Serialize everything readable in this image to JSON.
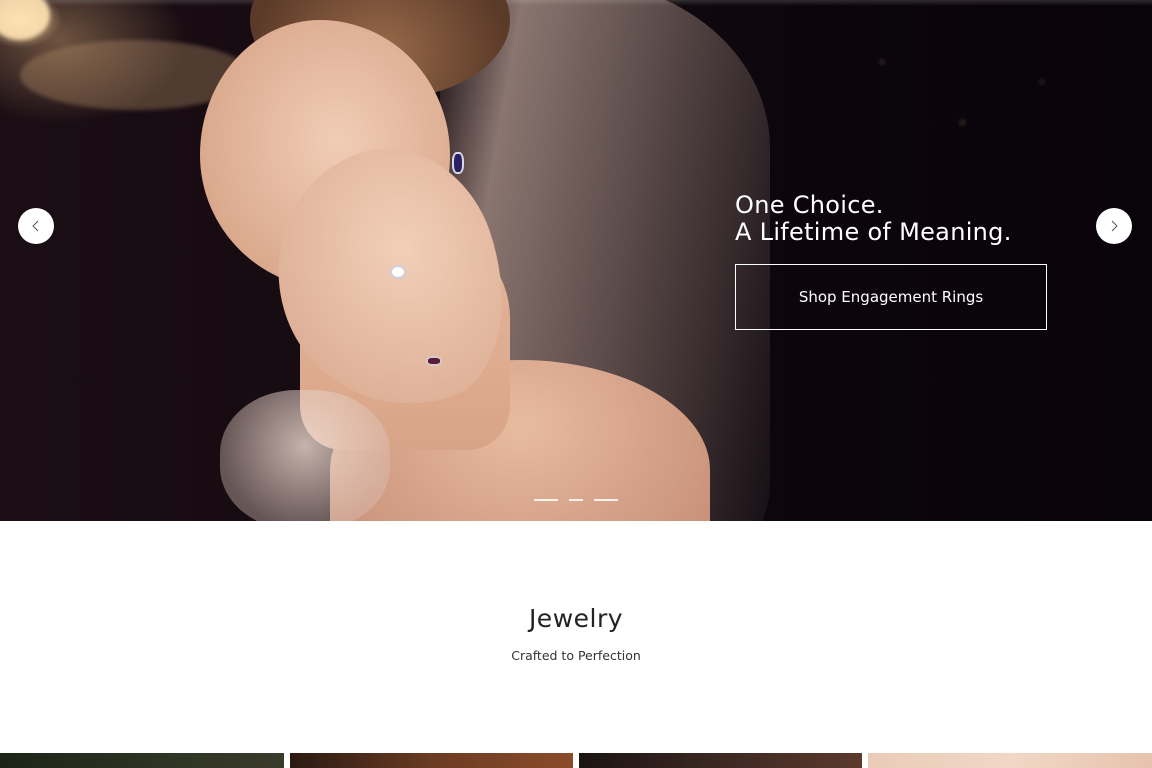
{
  "hero": {
    "heading_line1": "One Choice.",
    "heading_line2": "A Lifetime of Meaning.",
    "cta_label": "Shop Engagement Rings",
    "prev_icon": "chevron-left-icon",
    "next_icon": "chevron-right-icon",
    "slides_count": 3,
    "active_slide": 2
  },
  "section": {
    "title": "Jewelry",
    "subtitle": "Crafted to Perfection"
  },
  "colors": {
    "hero_bg": "#0c060c",
    "text_light": "#ffffff",
    "text_dark": "#222222"
  }
}
